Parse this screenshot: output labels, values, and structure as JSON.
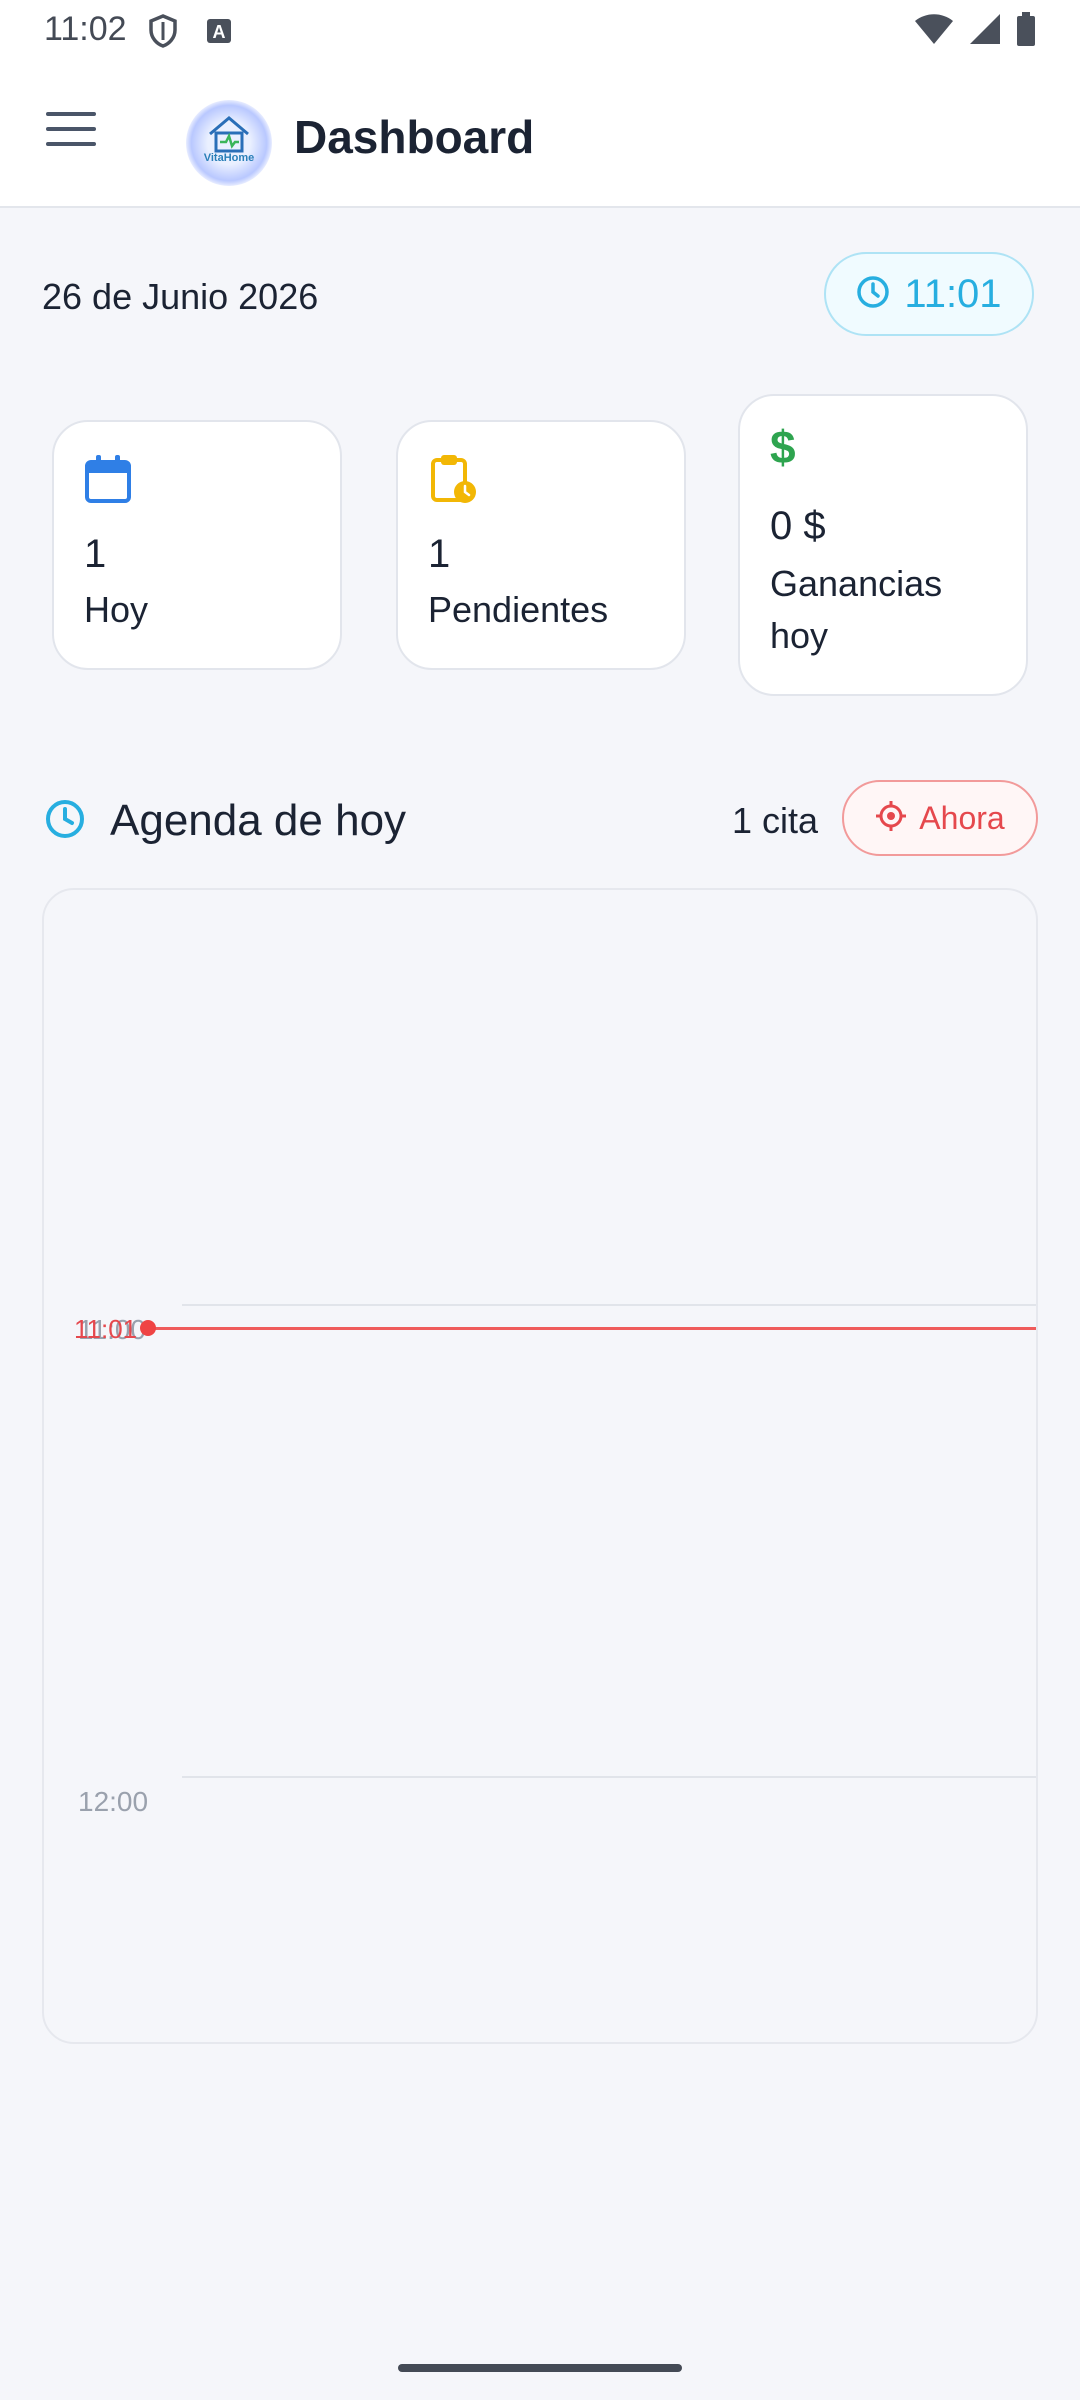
{
  "status_bar": {
    "time": "11:02",
    "left_icons": [
      "shield-icon",
      "font-a-icon"
    ],
    "right_icons": [
      "wifi-icon",
      "signal-icon",
      "battery-icon"
    ]
  },
  "app_bar": {
    "title": "Dashboard",
    "logo_text": "VitaHome",
    "menu_icon": "menu-icon"
  },
  "summary": {
    "date": "26 de Junio 2026",
    "current_time": "11:01"
  },
  "stats": [
    {
      "icon": "calendar-icon",
      "value": "1",
      "label": "Hoy",
      "color": "#2f7fe6"
    },
    {
      "icon": "clipboard-clock-icon",
      "value": "1",
      "label": "Pendientes",
      "color": "#f2b705"
    },
    {
      "icon": "dollar-icon",
      "value": "0 $",
      "label_line1": "Ganancias",
      "label_line2": "hoy",
      "color": "#2ea44f"
    }
  ],
  "agenda": {
    "title": "Agenda de hoy",
    "count": "1 cita",
    "now_button": "Ahora",
    "hours": [
      "11:00",
      "12:00"
    ],
    "now_time": "11:01"
  },
  "colors": {
    "accent_blue": "#27aee0",
    "now_red": "#e5484d"
  }
}
